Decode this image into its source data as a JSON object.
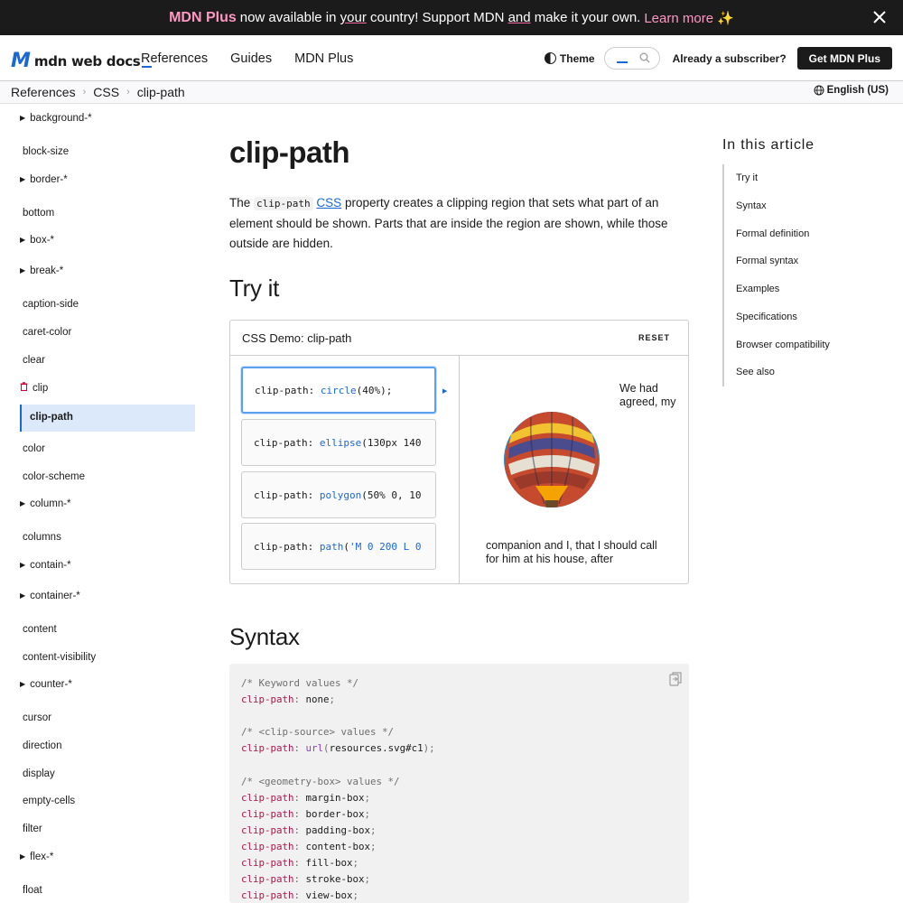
{
  "banner": {
    "brand": "MDN Plus",
    "text_a": "now available in",
    "text_your": "your",
    "text_b": "country! Support MDN",
    "text_and": "and",
    "text_c": "make it your own.",
    "learn_more": "Learn more ✨"
  },
  "header": {
    "logo_text": "mdn web docs",
    "nav": [
      "References",
      "Guides",
      "MDN Plus"
    ],
    "theme_label": "Theme",
    "subscriber_label": "Already a subscriber?",
    "get_plus_label": "Get MDN Plus"
  },
  "breadcrumbs": [
    "References",
    "CSS",
    "clip-path"
  ],
  "language": "English (US)",
  "sidebar": {
    "items": [
      {
        "label": "background-*",
        "group": true
      },
      {
        "label": "block-size",
        "group": false
      },
      {
        "label": "border-*",
        "group": true
      },
      {
        "label": "bottom",
        "group": false
      },
      {
        "label": "box-*",
        "group": true
      },
      {
        "label": "break-*",
        "group": true
      },
      {
        "label": "caption-side",
        "group": false
      },
      {
        "label": "caret-color",
        "group": false
      },
      {
        "label": "clear",
        "group": false
      },
      {
        "label": "clip",
        "group": false,
        "deprecated": true
      },
      {
        "label": "clip-path",
        "group": false,
        "active": true
      },
      {
        "label": "color",
        "group": false
      },
      {
        "label": "color-scheme",
        "group": false
      },
      {
        "label": "column-*",
        "group": true
      },
      {
        "label": "columns",
        "group": false
      },
      {
        "label": "contain-*",
        "group": true
      },
      {
        "label": "container-*",
        "group": true
      },
      {
        "label": "content",
        "group": false
      },
      {
        "label": "content-visibility",
        "group": false
      },
      {
        "label": "counter-*",
        "group": true
      },
      {
        "label": "cursor",
        "group": false
      },
      {
        "label": "direction",
        "group": false
      },
      {
        "label": "display",
        "group": false
      },
      {
        "label": "empty-cells",
        "group": false
      },
      {
        "label": "filter",
        "group": false
      },
      {
        "label": "flex-*",
        "group": true
      },
      {
        "label": "float",
        "group": false
      }
    ]
  },
  "article": {
    "title": "clip-path",
    "intro_a": "The",
    "intro_code": "clip-path",
    "intro_link": "CSS",
    "intro_b": "property creates a clipping region that sets what part of an element should be shown. Parts that are inside the region are shown, while those outside are hidden.",
    "try_it_heading": "Try it",
    "syntax_heading": "Syntax"
  },
  "demo": {
    "title": "CSS Demo: clip-path",
    "reset_label": "RESET",
    "options": [
      {
        "prop": "clip-path:",
        "fn": "circle",
        "args": "(40%);"
      },
      {
        "prop": "clip-path:",
        "fn": "ellipse",
        "args": "(130px 140"
      },
      {
        "prop": "clip-path:",
        "fn": "polygon",
        "args": "(50% 0, 10"
      },
      {
        "prop": "clip-path:",
        "fn": "path",
        "args": "(",
        "str": "'M 0 200 L 0"
      }
    ],
    "text_top": "We had agreed, my",
    "text_bottom": "companion and I, that I should call for him at his house, after"
  },
  "syntax_code": [
    {
      "type": "comment",
      "text": "/* Keyword values */"
    },
    {
      "type": "decl",
      "prop": "clip-path",
      "value": "none"
    },
    {
      "type": "blank"
    },
    {
      "type": "comment",
      "text": "/* <clip-source> values */"
    },
    {
      "type": "decl-fn",
      "prop": "clip-path",
      "fn": "url",
      "arg": "resources.svg#c1"
    },
    {
      "type": "blank"
    },
    {
      "type": "comment",
      "text": "/* <geometry-box> values */"
    },
    {
      "type": "decl",
      "prop": "clip-path",
      "value": "margin-box"
    },
    {
      "type": "decl",
      "prop": "clip-path",
      "value": "border-box"
    },
    {
      "type": "decl",
      "prop": "clip-path",
      "value": "padding-box"
    },
    {
      "type": "decl",
      "prop": "clip-path",
      "value": "content-box"
    },
    {
      "type": "decl",
      "prop": "clip-path",
      "value": "fill-box"
    },
    {
      "type": "decl",
      "prop": "clip-path",
      "value": "stroke-box"
    },
    {
      "type": "decl",
      "prop": "clip-path",
      "value": "view-box"
    }
  ],
  "toc": {
    "title": "In this article",
    "items": [
      "Try it",
      "Syntax",
      "Formal definition",
      "Formal syntax",
      "Examples",
      "Specifications",
      "Browser compatibility",
      "See also"
    ]
  },
  "colors": {
    "accent": "#1a68d6",
    "brand_pink": "#ff97c3",
    "active_bg": "#dce9fb",
    "code_prop": "#b4134c"
  }
}
